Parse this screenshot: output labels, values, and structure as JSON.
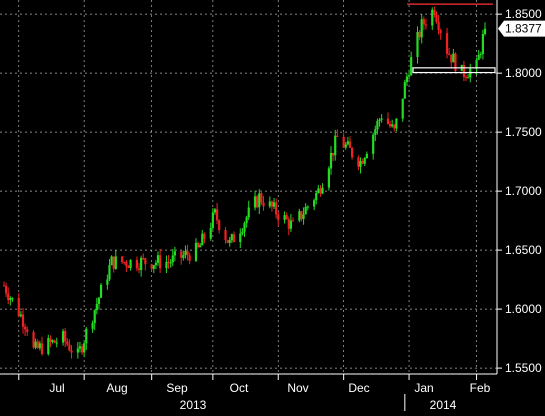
{
  "chart_data": {
    "type": "candlestick",
    "title": "",
    "xlabel": "",
    "ylabel": "",
    "ylim": [
      1.545,
      1.862
    ],
    "yticks": [
      "1.5500",
      "1.6000",
      "1.6500",
      "1.7000",
      "1.7500",
      "1.8000",
      "1.8500"
    ],
    "months": [
      "Jul",
      "Aug",
      "Sep",
      "Oct",
      "Nov",
      "Dec",
      "Jan",
      "Feb"
    ],
    "years": [
      "2013",
      "2014"
    ],
    "last_price": "1.8377",
    "resistance_level": 1.8585,
    "support_zone": [
      1.8005,
      1.8045
    ],
    "grid": true,
    "colors": {
      "up": "#22dd22",
      "down": "#ee2222",
      "grid": "#ffffff",
      "resistance": "#ff3333",
      "support": "#ffffff",
      "label_bg": "#ffffff"
    },
    "key_closes": [
      {
        "x": "2013-06-24",
        "y": 1.62
      },
      {
        "x": "2013-07-05",
        "y": 1.585
      },
      {
        "x": "2013-07-08",
        "y": 1.565
      },
      {
        "x": "2013-07-22",
        "y": 1.575
      },
      {
        "x": "2013-07-29",
        "y": 1.56
      },
      {
        "x": "2013-08-06",
        "y": 1.6
      },
      {
        "x": "2013-08-14",
        "y": 1.64
      },
      {
        "x": "2013-08-26",
        "y": 1.64
      },
      {
        "x": "2013-09-10",
        "y": 1.64
      },
      {
        "x": "2013-09-24",
        "y": 1.65
      },
      {
        "x": "2013-10-02",
        "y": 1.68
      },
      {
        "x": "2013-10-09",
        "y": 1.655
      },
      {
        "x": "2013-10-23",
        "y": 1.695
      },
      {
        "x": "2013-11-08",
        "y": 1.67
      },
      {
        "x": "2013-11-20",
        "y": 1.7
      },
      {
        "x": "2013-11-29",
        "y": 1.745
      },
      {
        "x": "2013-12-10",
        "y": 1.725
      },
      {
        "x": "2013-12-20",
        "y": 1.765
      },
      {
        "x": "2013-12-26",
        "y": 1.75
      },
      {
        "x": "2014-01-02",
        "y": 1.805
      },
      {
        "x": "2014-01-08",
        "y": 1.84
      },
      {
        "x": "2014-01-14",
        "y": 1.855
      },
      {
        "x": "2014-01-20",
        "y": 1.82
      },
      {
        "x": "2014-01-27",
        "y": 1.8
      },
      {
        "x": "2014-02-03",
        "y": 1.805
      },
      {
        "x": "2014-02-07",
        "y": 1.8377
      }
    ]
  }
}
